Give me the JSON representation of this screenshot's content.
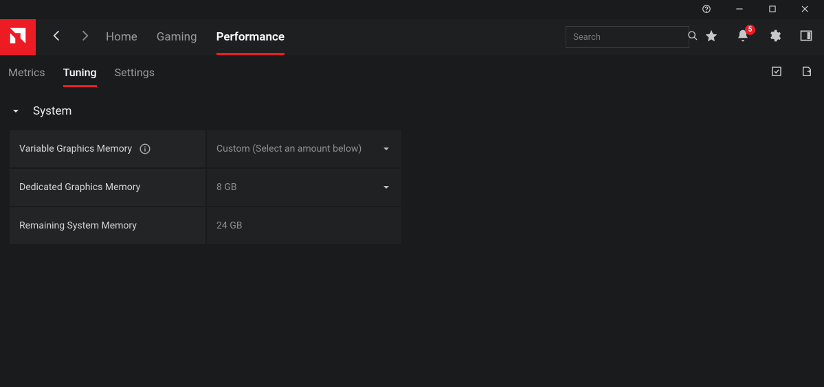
{
  "titlebar": {
    "help_tip": "Help",
    "min": "Minimize",
    "max": "Maximize",
    "close": "Close"
  },
  "nav": {
    "tabs": [
      {
        "label": "Home",
        "active": false
      },
      {
        "label": "Gaming",
        "active": false
      },
      {
        "label": "Performance",
        "active": true
      }
    ]
  },
  "search": {
    "placeholder": "Search"
  },
  "notifications": {
    "count": "5"
  },
  "subtabs": {
    "items": [
      {
        "label": "Metrics",
        "active": false
      },
      {
        "label": "Tuning",
        "active": true
      },
      {
        "label": "Settings",
        "active": false
      }
    ]
  },
  "section": {
    "title": "System"
  },
  "settings": {
    "rows": [
      {
        "label": "Variable Graphics Memory",
        "value": "Custom (Select an amount below)",
        "has_info": true,
        "has_dropdown": true,
        "interactable": true
      },
      {
        "label": "Dedicated Graphics Memory",
        "value": "8 GB",
        "has_info": false,
        "has_dropdown": true,
        "interactable": true
      },
      {
        "label": "Remaining System Memory",
        "value": "24 GB",
        "has_info": false,
        "has_dropdown": false,
        "interactable": false
      }
    ]
  }
}
